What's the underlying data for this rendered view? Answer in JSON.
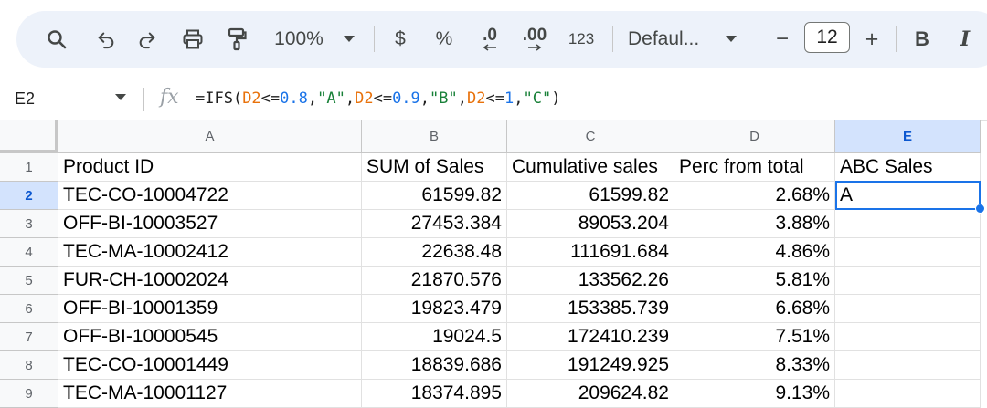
{
  "toolbar": {
    "icons": [
      "search-icon",
      "undo-icon",
      "redo-icon",
      "print-icon",
      "paint-format-icon"
    ],
    "zoom": "100%",
    "currency": "$",
    "percent": "%",
    "decrease_decimal": ".0",
    "increase_decimal": ".00",
    "number_format": "123",
    "font": "Defaul...",
    "font_size_minus": "−",
    "font_size": "12",
    "font_size_plus": "+",
    "bold": "B",
    "italic": "I"
  },
  "formula_bar": {
    "name_box": "E2",
    "fx": "fx",
    "formula_parts": [
      {
        "text": "=IFS(",
        "color": "#1f1f1f"
      },
      {
        "text": "D2",
        "color": "#e8710a"
      },
      {
        "text": "<=",
        "color": "#1f1f1f"
      },
      {
        "text": "0.8",
        "color": "#1a73e8"
      },
      {
        "text": ",",
        "color": "#1f1f1f"
      },
      {
        "text": "\"A\"",
        "color": "#188038"
      },
      {
        "text": ",",
        "color": "#1f1f1f"
      },
      {
        "text": "D2",
        "color": "#e8710a"
      },
      {
        "text": "<=",
        "color": "#1f1f1f"
      },
      {
        "text": "0.9",
        "color": "#1a73e8"
      },
      {
        "text": ",",
        "color": "#1f1f1f"
      },
      {
        "text": "\"B\"",
        "color": "#188038"
      },
      {
        "text": ",",
        "color": "#1f1f1f"
      },
      {
        "text": "D2",
        "color": "#e8710a"
      },
      {
        "text": "<=",
        "color": "#1f1f1f"
      },
      {
        "text": "1",
        "color": "#1a73e8"
      },
      {
        "text": ",",
        "color": "#1f1f1f"
      },
      {
        "text": "\"C\"",
        "color": "#188038"
      },
      {
        "text": ")",
        "color": "#1f1f1f"
      }
    ]
  },
  "grid": {
    "columns": [
      "A",
      "B",
      "C",
      "D",
      "E"
    ],
    "selected_column": "E",
    "selected_row": "2",
    "rows": [
      {
        "num": "1",
        "cells": [
          "Product ID",
          "SUM of Sales",
          "Cumulative sales",
          "Perc from total",
          "ABC Sales"
        ]
      },
      {
        "num": "2",
        "cells": [
          "TEC-CO-10004722",
          "61599.82",
          "61599.82",
          "2.68%",
          "A"
        ]
      },
      {
        "num": "3",
        "cells": [
          "OFF-BI-10003527",
          "27453.384",
          "89053.204",
          "3.88%",
          ""
        ]
      },
      {
        "num": "4",
        "cells": [
          "TEC-MA-10002412",
          "22638.48",
          "111691.684",
          "4.86%",
          ""
        ]
      },
      {
        "num": "5",
        "cells": [
          "FUR-CH-10002024",
          "21870.576",
          "133562.26",
          "5.81%",
          ""
        ]
      },
      {
        "num": "6",
        "cells": [
          "OFF-BI-10001359",
          "19823.479",
          "153385.739",
          "6.68%",
          ""
        ]
      },
      {
        "num": "7",
        "cells": [
          "OFF-BI-10000545",
          "19024.5",
          "172410.239",
          "7.51%",
          ""
        ]
      },
      {
        "num": "8",
        "cells": [
          "TEC-CO-10001449",
          "18839.686",
          "191249.925",
          "8.33%",
          ""
        ]
      },
      {
        "num": "9",
        "cells": [
          "TEC-MA-10001127",
          "18374.895",
          "209624.82",
          "9.13%",
          ""
        ]
      }
    ]
  }
}
